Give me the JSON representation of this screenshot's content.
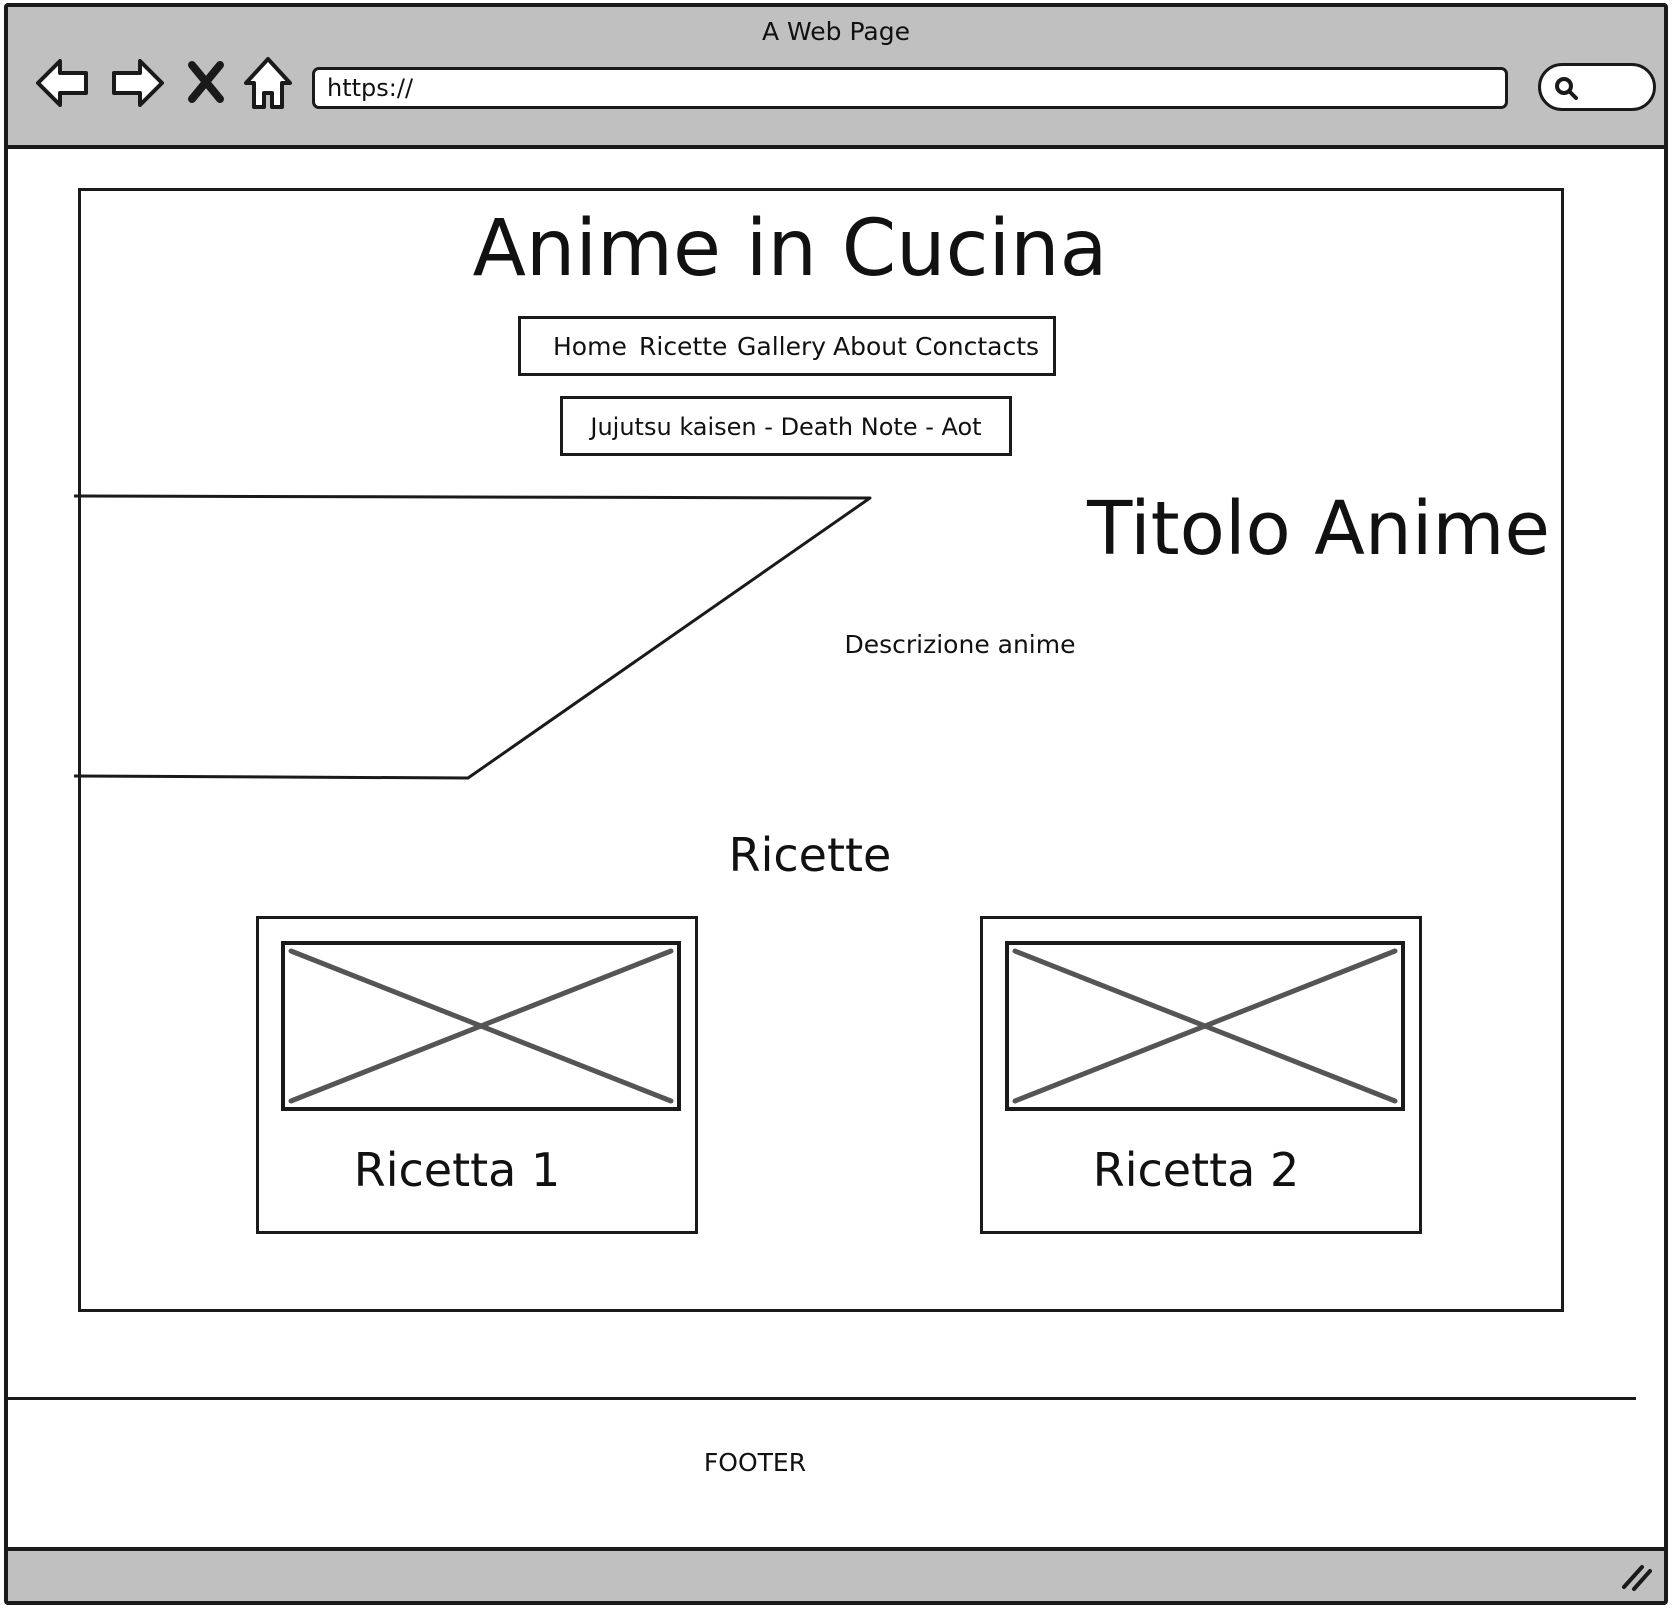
{
  "browser": {
    "window_title": "A Web Page",
    "url": "https://",
    "nav_icons": [
      "back-icon",
      "forward-icon",
      "close-icon",
      "home-icon"
    ],
    "search_icon": "search-icon",
    "resize_icon": "resize-grip-icon"
  },
  "header": {
    "site_title": "Anime in Cucina",
    "menu": [
      {
        "label": "Home"
      },
      {
        "label": "Ricette"
      },
      {
        "label": "Gallery"
      },
      {
        "label": "About"
      },
      {
        "label": "Conctacts"
      }
    ],
    "anime_selector": "Jujutsu kaisen - Death Note - Aot"
  },
  "hero": {
    "title": "Titolo Anime",
    "description": "Descrizione anime"
  },
  "recipes": {
    "section_title": "Ricette",
    "cards": [
      {
        "label": "Ricetta 1"
      },
      {
        "label": "Ricetta 2"
      }
    ]
  },
  "footer": {
    "text": "FOOTER"
  },
  "colors": {
    "chrome": "#c0c0c0",
    "stroke": "#1a1a1a",
    "placeholder_cross": "#555555"
  }
}
